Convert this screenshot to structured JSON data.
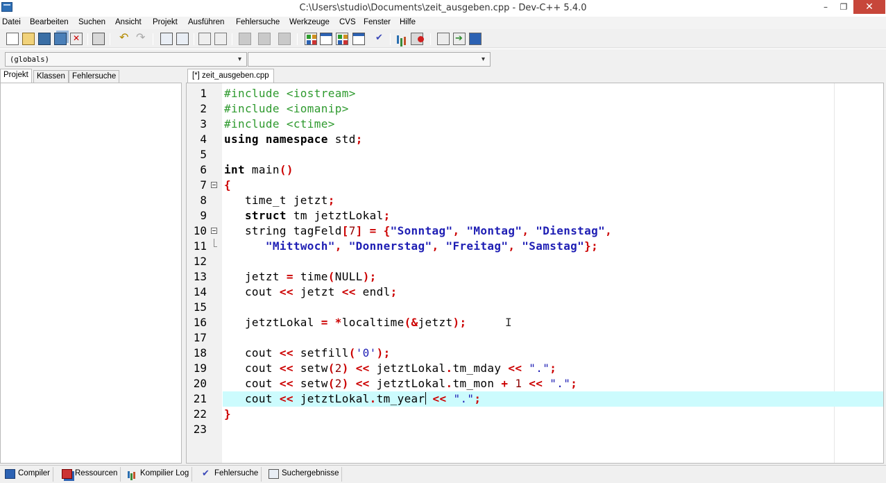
{
  "window": {
    "title": "C:\\Users\\studio\\Documents\\zeit_ausgeben.cpp - Dev-C++ 5.4.0",
    "minimize": "–",
    "maximize": "❐",
    "close": "✕"
  },
  "menu": [
    "Datei",
    "Bearbeiten",
    "Suchen",
    "Ansicht",
    "Projekt",
    "Ausführen",
    "Fehlersuche",
    "Werkzeuge",
    "CVS",
    "Fenster",
    "Hilfe"
  ],
  "toolbar_icons": [
    "new-file-icon",
    "open-project-icon",
    "save-icon",
    "save-all-icon",
    "close-file-icon",
    "print-icon",
    "undo-icon",
    "redo-icon",
    "find-icon",
    "replace-icon",
    "indent-icon",
    "unindent-icon",
    "bookmark-disabled-icon",
    "goto-disabled-icon",
    "toggle-disabled-icon",
    "compile-icon",
    "window-icon",
    "run-icon",
    "check-icon",
    "chart-icon",
    "debug-icon",
    "pin-icon",
    "goto-arrow-icon",
    "help-book-icon"
  ],
  "selectors": {
    "scope": "(globals)",
    "member": ""
  },
  "left_tabs": [
    "Projekt",
    "Klassen",
    "Fehlersuche"
  ],
  "editor": {
    "file_tab": "[*] zeit_ausgeben.cpp",
    "highlight_line": 21
  },
  "code_lines": [
    {
      "n": "1"
    },
    {
      "n": "2"
    },
    {
      "n": "3"
    },
    {
      "n": "4"
    },
    {
      "n": "5"
    },
    {
      "n": "6"
    },
    {
      "n": "7"
    },
    {
      "n": "8"
    },
    {
      "n": "9"
    },
    {
      "n": "10"
    },
    {
      "n": "11"
    },
    {
      "n": "12"
    },
    {
      "n": "13"
    },
    {
      "n": "14"
    },
    {
      "n": "15"
    },
    {
      "n": "16"
    },
    {
      "n": "17"
    },
    {
      "n": "18"
    },
    {
      "n": "19"
    },
    {
      "n": "20"
    },
    {
      "n": "21"
    },
    {
      "n": "22"
    },
    {
      "n": "23"
    }
  ],
  "code": {
    "l1a": "#include <iostream>",
    "l2a": "#include <iomanip>",
    "l3a": "#include <ctime>",
    "l4a": "using",
    "l4b": " ",
    "l4c": "namespace",
    "l4d": " std",
    "l4e": ";",
    "l6a": "int",
    "l6b": " main",
    "l6c": "()",
    "l7a": "{",
    "l8a": "   time_t jetzt",
    "l8b": ";",
    "l9a": "   ",
    "l9b": "struct",
    "l9c": " tm jetztLokal",
    "l9d": ";",
    "l10a": "   string tagFeld",
    "l10b": "[",
    "l10c": "7",
    "l10d": "]",
    "l10e": " ",
    "l10f": "=",
    "l10g": " ",
    "l10h": "{",
    "l10i": "\"Sonntag\"",
    "l10j": ",",
    "l10k": " ",
    "l10l": "\"Montag\"",
    "l10m": ",",
    "l10n": " ",
    "l10o": "\"Dienstag\"",
    "l10p": ",",
    "l11a": "      ",
    "l11b": "\"Mittwoch\"",
    "l11c": ",",
    "l11d": " ",
    "l11e": "\"Donnerstag\"",
    "l11f": ",",
    "l11g": " ",
    "l11h": "\"Freitag\"",
    "l11i": ",",
    "l11j": " ",
    "l11k": "\"Samstag\"",
    "l11l": "};",
    "l13a": "   jetzt ",
    "l13b": "=",
    "l13c": " time",
    "l13d": "(",
    "l13e": "NULL",
    "l13f": ");",
    "l14a": "   cout ",
    "l14b": "<<",
    "l14c": " jetzt ",
    "l14d": "<<",
    "l14e": " endl",
    "l14f": ";",
    "l16a": "   jetztLokal ",
    "l16b": "=",
    "l16c": " ",
    "l16d": "*",
    "l16e": "localtime",
    "l16f": "(&",
    "l16g": "jetzt",
    "l16h": ");",
    "l18a": "   cout ",
    "l18b": "<<",
    "l18c": " setfill",
    "l18d": "(",
    "l18e": "'0'",
    "l18f": ");",
    "l19a": "   cout ",
    "l19b": "<<",
    "l19c": " setw",
    "l19d": "(",
    "l19e": "2",
    "l19f": ")",
    "l19g": " ",
    "l19h": "<<",
    "l19i": " jetztLokal",
    "l19j": ".",
    "l19k": "tm_mday ",
    "l19l": "<<",
    "l19m": " ",
    "l19n": "\".\"",
    "l19o": ";",
    "l20a": "   cout ",
    "l20b": "<<",
    "l20c": " setw",
    "l20d": "(",
    "l20e": "2",
    "l20f": ")",
    "l20g": " ",
    "l20h": "<<",
    "l20i": " jetztLokal",
    "l20j": ".",
    "l20k": "tm_mon ",
    "l20l": "+",
    "l20m": " ",
    "l20n": "1",
    "l20o": " ",
    "l20p": "<<",
    "l20q": " ",
    "l20r": "\".\"",
    "l20s": ";",
    "l21a": "   cout ",
    "l21b": "<<",
    "l21c": " jetztLokal",
    "l21d": ".",
    "l21e": "tm_year",
    "l21f": " ",
    "l21g": "<<",
    "l21h": " ",
    "l21i": "\".\"",
    "l21j": ";",
    "l22a": "}"
  },
  "bottom_tabs": [
    "Compiler",
    "Ressourcen",
    "Kompilier Log",
    "Fehlersuche",
    "Suchergebnisse"
  ],
  "colors": {
    "preprocessor": "#2e9a2e",
    "operator": "#cc0000",
    "string": "#1e1eb4",
    "number": "#8c0000",
    "current_line": "#ccfbfd"
  }
}
